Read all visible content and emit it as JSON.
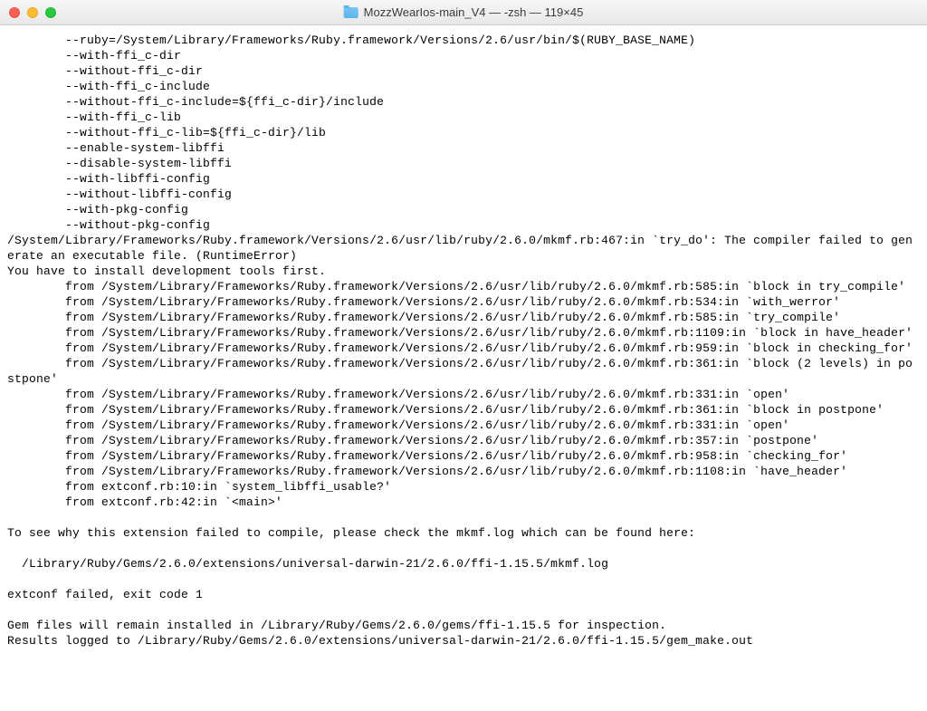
{
  "window": {
    "title": "MozzWearIos-main_V4 — -zsh — 119×45"
  },
  "terminal": {
    "lines": [
      "        --ruby=/System/Library/Frameworks/Ruby.framework/Versions/2.6/usr/bin/$(RUBY_BASE_NAME)",
      "        --with-ffi_c-dir",
      "        --without-ffi_c-dir",
      "        --with-ffi_c-include",
      "        --without-ffi_c-include=${ffi_c-dir}/include",
      "        --with-ffi_c-lib",
      "        --without-ffi_c-lib=${ffi_c-dir}/lib",
      "        --enable-system-libffi",
      "        --disable-system-libffi",
      "        --with-libffi-config",
      "        --without-libffi-config",
      "        --with-pkg-config",
      "        --without-pkg-config",
      "/System/Library/Frameworks/Ruby.framework/Versions/2.6/usr/lib/ruby/2.6.0/mkmf.rb:467:in `try_do': The compiler failed to generate an executable file. (RuntimeError)",
      "You have to install development tools first.",
      "        from /System/Library/Frameworks/Ruby.framework/Versions/2.6/usr/lib/ruby/2.6.0/mkmf.rb:585:in `block in try_compile'",
      "        from /System/Library/Frameworks/Ruby.framework/Versions/2.6/usr/lib/ruby/2.6.0/mkmf.rb:534:in `with_werror'",
      "        from /System/Library/Frameworks/Ruby.framework/Versions/2.6/usr/lib/ruby/2.6.0/mkmf.rb:585:in `try_compile'",
      "        from /System/Library/Frameworks/Ruby.framework/Versions/2.6/usr/lib/ruby/2.6.0/mkmf.rb:1109:in `block in have_header'",
      "        from /System/Library/Frameworks/Ruby.framework/Versions/2.6/usr/lib/ruby/2.6.0/mkmf.rb:959:in `block in checking_for'",
      "        from /System/Library/Frameworks/Ruby.framework/Versions/2.6/usr/lib/ruby/2.6.0/mkmf.rb:361:in `block (2 levels) in postpone'",
      "        from /System/Library/Frameworks/Ruby.framework/Versions/2.6/usr/lib/ruby/2.6.0/mkmf.rb:331:in `open'",
      "        from /System/Library/Frameworks/Ruby.framework/Versions/2.6/usr/lib/ruby/2.6.0/mkmf.rb:361:in `block in postpone'",
      "        from /System/Library/Frameworks/Ruby.framework/Versions/2.6/usr/lib/ruby/2.6.0/mkmf.rb:331:in `open'",
      "        from /System/Library/Frameworks/Ruby.framework/Versions/2.6/usr/lib/ruby/2.6.0/mkmf.rb:357:in `postpone'",
      "        from /System/Library/Frameworks/Ruby.framework/Versions/2.6/usr/lib/ruby/2.6.0/mkmf.rb:958:in `checking_for'",
      "        from /System/Library/Frameworks/Ruby.framework/Versions/2.6/usr/lib/ruby/2.6.0/mkmf.rb:1108:in `have_header'",
      "        from extconf.rb:10:in `system_libffi_usable?'",
      "        from extconf.rb:42:in `<main>'",
      "",
      "To see why this extension failed to compile, please check the mkmf.log which can be found here:",
      "",
      "  /Library/Ruby/Gems/2.6.0/extensions/universal-darwin-21/2.6.0/ffi-1.15.5/mkmf.log",
      "",
      "extconf failed, exit code 1",
      "",
      "Gem files will remain installed in /Library/Ruby/Gems/2.6.0/gems/ffi-1.15.5 for inspection.",
      "Results logged to /Library/Ruby/Gems/2.6.0/extensions/universal-darwin-21/2.6.0/ffi-1.15.5/gem_make.out"
    ]
  }
}
